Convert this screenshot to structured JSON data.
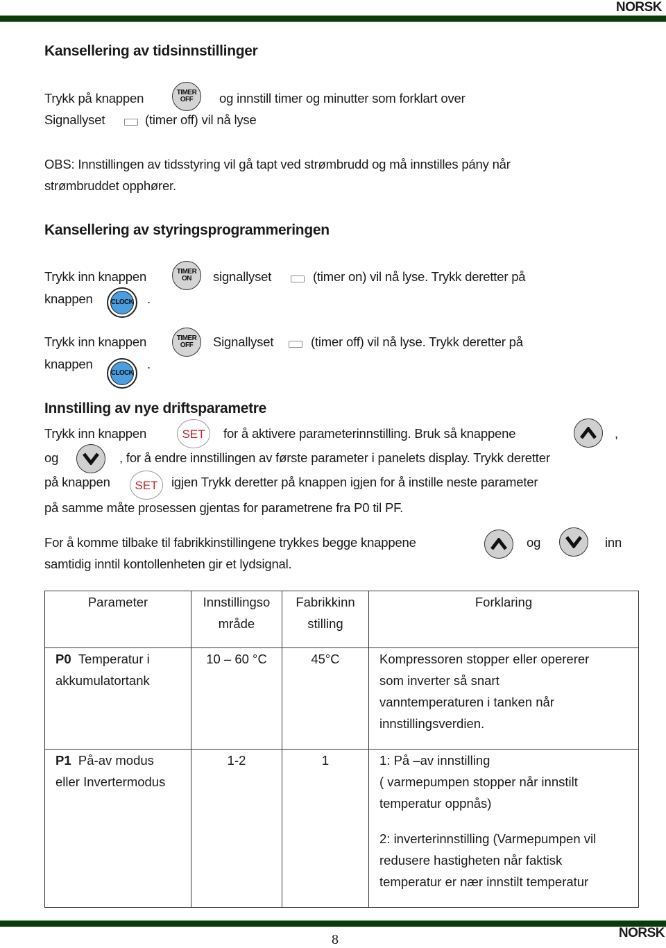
{
  "header": {
    "language": "NORSK",
    "bar_color": "#0b3a0b"
  },
  "section1": {
    "title": "Kansellering av tidsinnstillinger",
    "line1_pre": "Trykk på knappen",
    "line1_button": {
      "top": "TIMER",
      "bottom": "OFF"
    },
    "line1_post": "og innstill timer og minutter som forklart over",
    "line2_pre": "Signallyset",
    "line2_post": "(timer off) vil nå lyse",
    "note_line1": "OBS:  Innstillingen av tidsstyring vil gå tapt ved strømbrudd og må innstilles pány når",
    "note_line2": "strømbruddet opphører."
  },
  "section2": {
    "title": "Kansellering av styringsprogrammeringen",
    "row1": {
      "pre": "Trykk inn knappen",
      "button": {
        "top": "TIMER",
        "bottom": "ON"
      },
      "mid": "signallyset",
      "post": "(timer on) vil nå lyse.  Trykk deretter på",
      "line2_pre": "knappen",
      "clock": "CLOCK",
      "line2_post": "."
    },
    "row2": {
      "pre": "Trykk inn knappen",
      "button": {
        "top": "TIMER",
        "bottom": "OFF"
      },
      "mid": "Signallyset",
      "post": "(timer off) vil nå lyse.  Trykk deretter på",
      "line2_pre": "knappen",
      "clock": "CLOCK",
      "line2_post": "."
    }
  },
  "section3": {
    "title": "Innstilling av nye driftsparametre",
    "l1_pre": "Trykk inn knappen",
    "set_label": "SET",
    "l1_post": "for å aktivere parameterinnstilling.  Bruk så knappene",
    "l1_end": ",",
    "l2_pre": "og",
    "l2_post": ", for å endre innstillingen av første  parameter i panelets display.  Trykk deretter",
    "l3_pre": "på knappen",
    "l3_post": "igjen Trykk deretter på knappen igjen for å instille neste parameter",
    "l4": "på samme måte prosessen gjentas for parametrene fra P0 til PF.",
    "factory_pre": "For å komme tilbake til fabrikkinstillingene trykkes begge knappene",
    "factory_og": "og",
    "factory_inn": "inn",
    "factory_l2": "samtidig inntil kontollenheten gir et lydsignal."
  },
  "table": {
    "headers": [
      [
        "Parameter"
      ],
      [
        "Innstillingso",
        "mråde"
      ],
      [
        "Fabrikkinn",
        "stilling"
      ],
      [
        "Forklaring"
      ]
    ],
    "rows": [
      {
        "code": "P0",
        "name_line1": "Temperatur  i",
        "name_line2": "akkumulatortank",
        "range": "10 – 60 °C",
        "default": "45°C",
        "explanation": [
          "Kompressoren stopper eller opererer",
          "som inverter så snart",
          "vanntemperaturen i tanken når",
          "innstillingsverdien."
        ]
      },
      {
        "code": "P1",
        "name_line1": "På-av modus",
        "name_line2": "eller Invertermodus",
        "range": "1-2",
        "default": "1",
        "explanation": [
          "1: På –av  innstilling",
          "( varmepumpen stopper når innstilt",
          "temperatur oppnås)",
          "",
          "2: inverterinnstilling  (Varmepumpen vil",
          "redusere hastigheten når faktisk",
          "temperatur er nær innstilt temperatur"
        ]
      }
    ]
  },
  "footer": {
    "page_number": "8",
    "language": "NORSK"
  }
}
